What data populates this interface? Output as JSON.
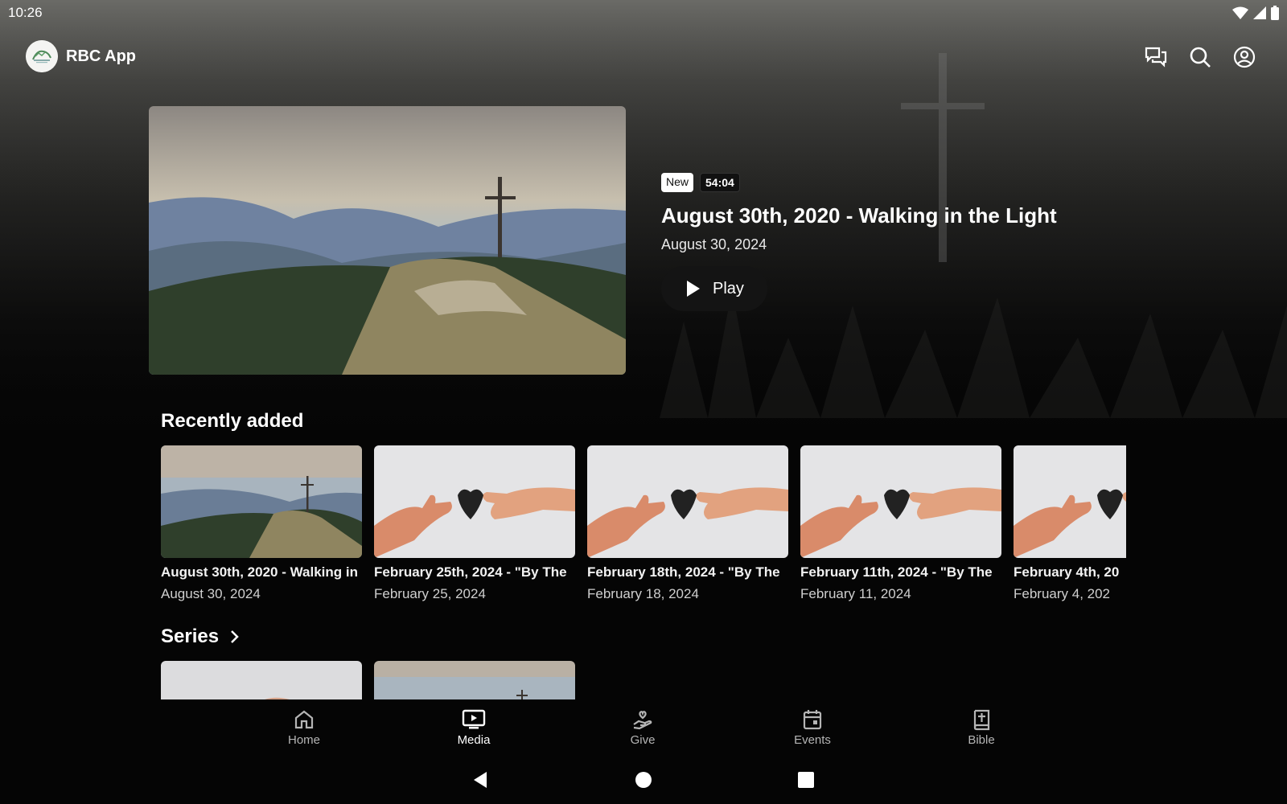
{
  "status_bar": {
    "time": "10:26"
  },
  "app": {
    "title": "RBC App"
  },
  "header_icons": [
    "messages-icon",
    "search-icon",
    "account-icon"
  ],
  "hero": {
    "badge_new": "New",
    "duration": "54:04",
    "title": "August 30th, 2020 - Walking in the Light",
    "date": "August 30, 2024",
    "play_label": "Play"
  },
  "recently_added": {
    "heading": "Recently added",
    "items": [
      {
        "title": "August 30th, 2020 - Walking in",
        "date": "August 30, 2024",
        "thumb": "mountain-cross"
      },
      {
        "title": "February 25th, 2024 - \"By The",
        "date": "February 25, 2024",
        "thumb": "hands-heart"
      },
      {
        "title": "February 18th, 2024 - \"By The",
        "date": "February 18, 2024",
        "thumb": "hands-heart"
      },
      {
        "title": "February 11th, 2024 - \"By The",
        "date": "February 11, 2024",
        "thumb": "hands-heart"
      },
      {
        "title": "February 4th, 20",
        "date": "February 4, 202",
        "thumb": "hands-heart"
      }
    ]
  },
  "series": {
    "heading": "Series"
  },
  "bottom_nav": {
    "active": "Media",
    "items": [
      {
        "label": "Home",
        "icon": "home-icon"
      },
      {
        "label": "Media",
        "icon": "media-icon"
      },
      {
        "label": "Give",
        "icon": "give-icon"
      },
      {
        "label": "Events",
        "icon": "calendar-icon"
      },
      {
        "label": "Bible",
        "icon": "bible-icon"
      }
    ]
  },
  "colors": {
    "background": "#050505",
    "text": "#ffffff",
    "muted": "#b5b5b5"
  }
}
